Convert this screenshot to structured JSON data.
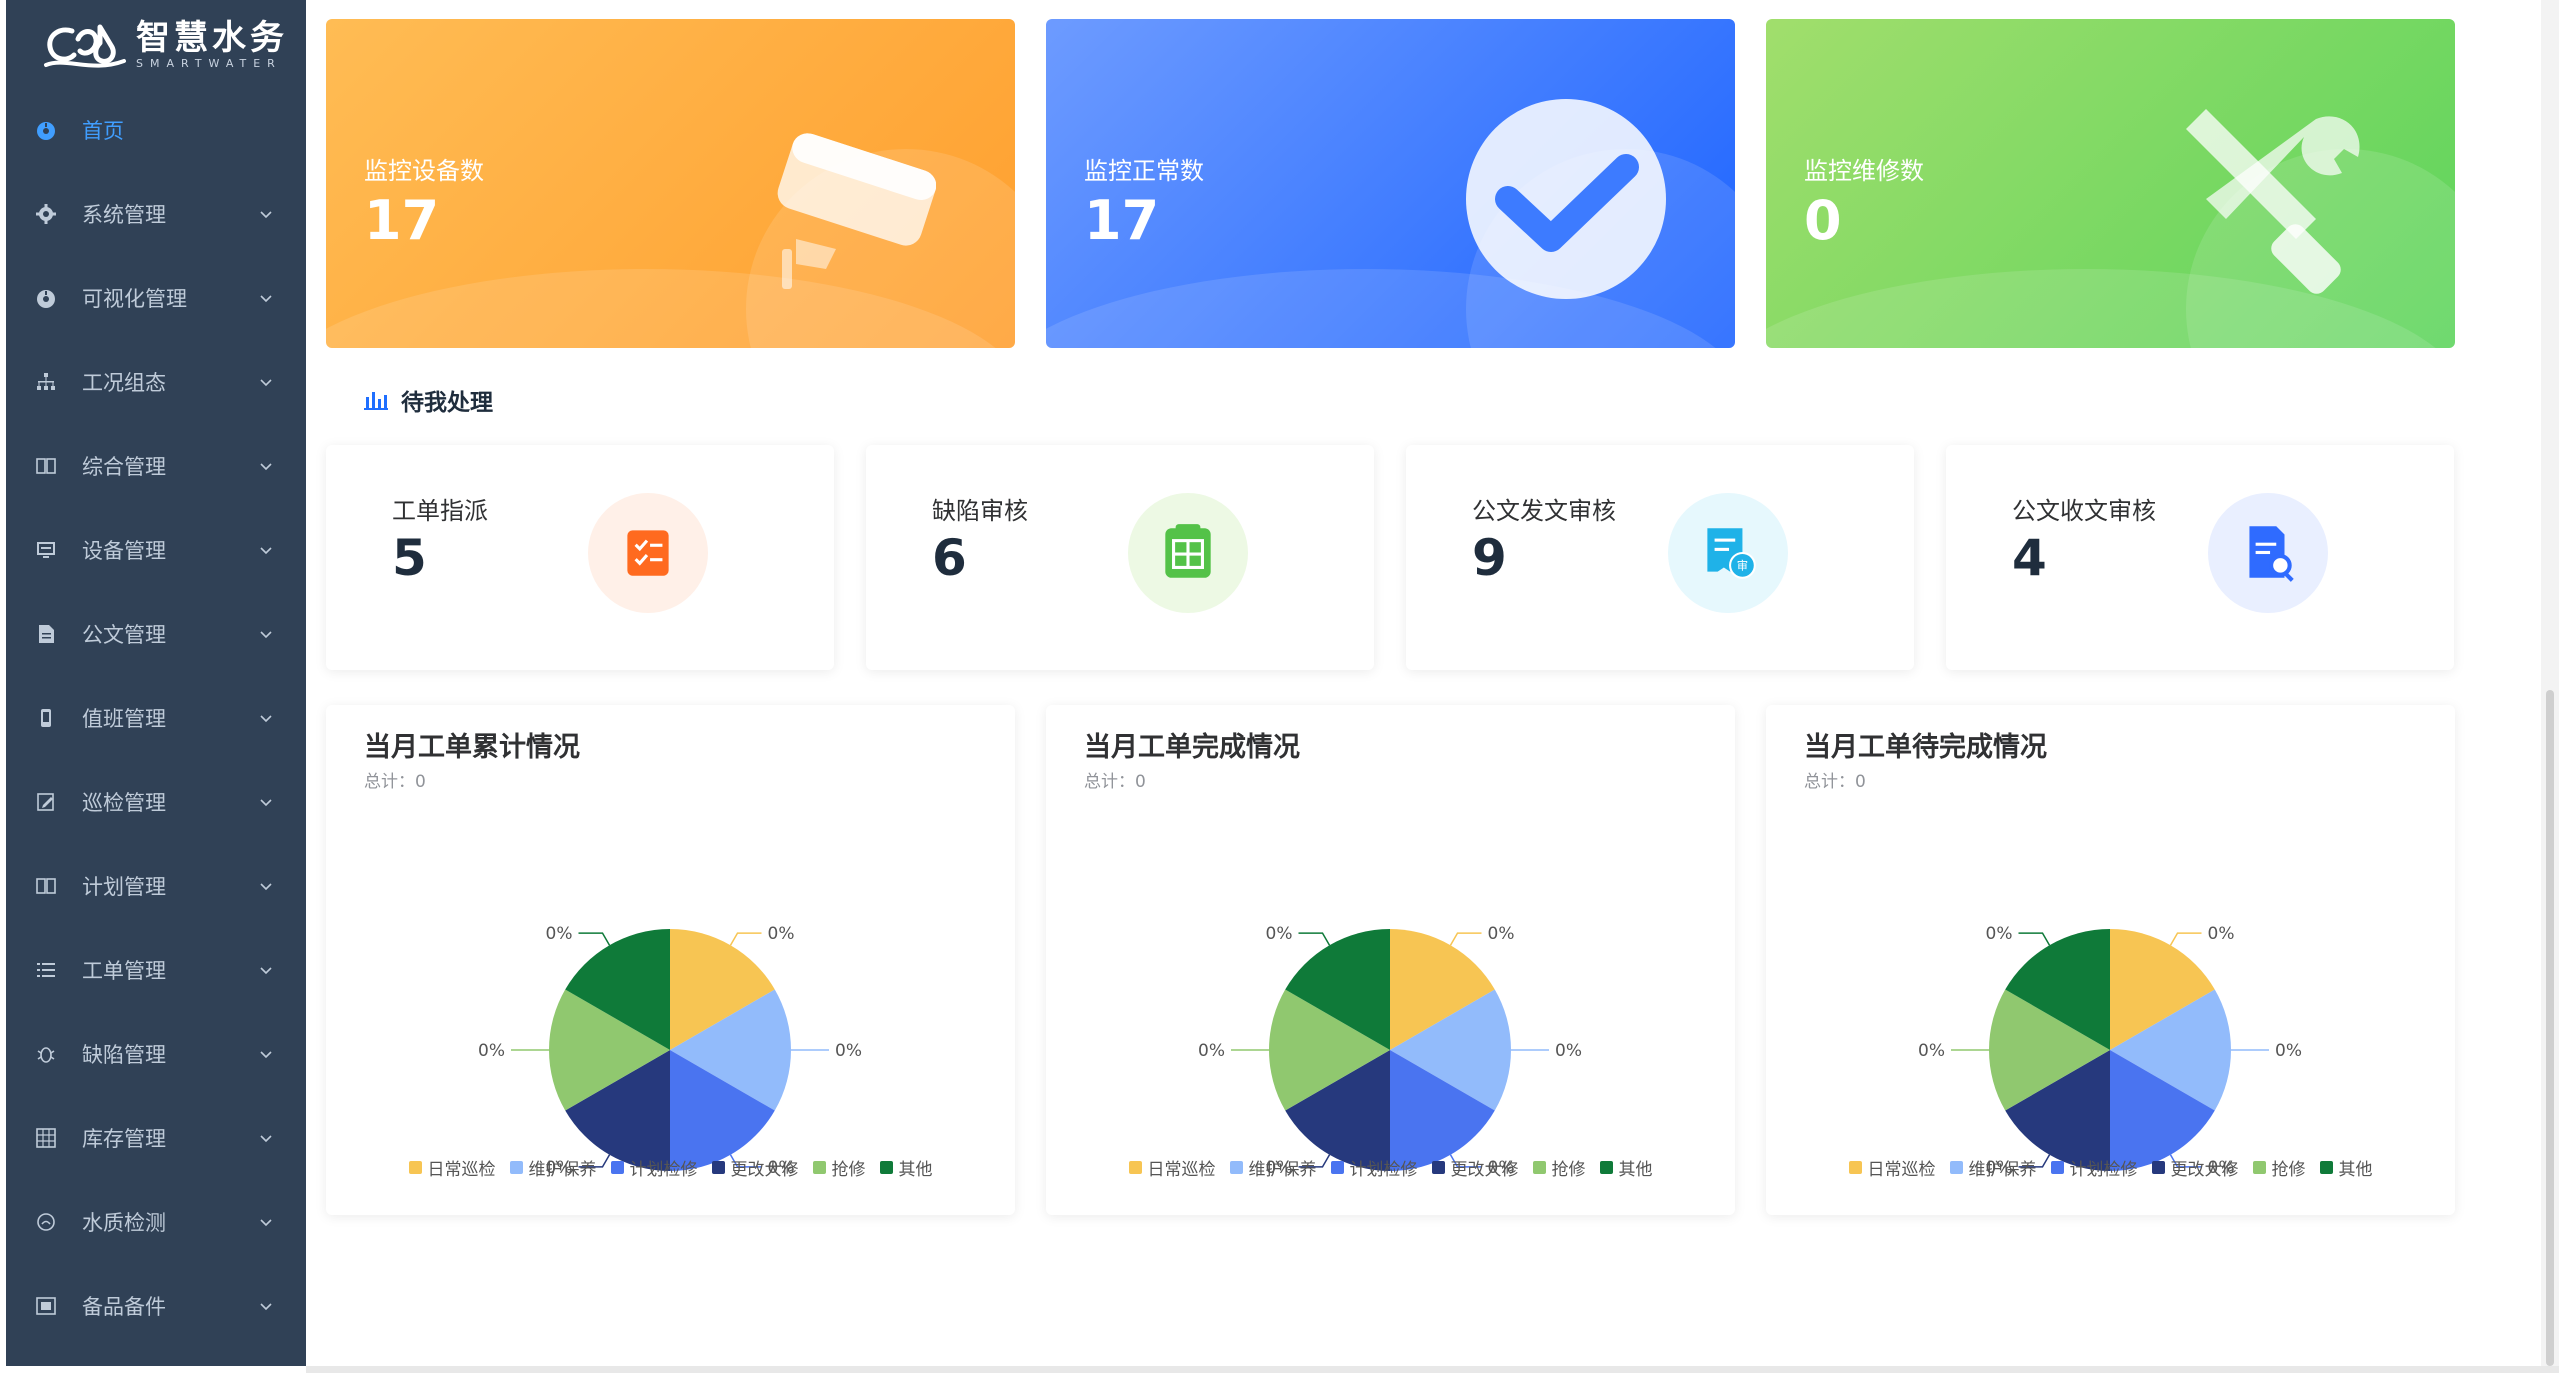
{
  "brand": {
    "name_cn": "智慧水务",
    "name_en": "SMARTWATER"
  },
  "menu": [
    {
      "label": "首页",
      "icon": "dashboard-icon",
      "active": true,
      "expandable": false
    },
    {
      "label": "系统管理",
      "icon": "gear-icon",
      "expandable": true
    },
    {
      "label": "可视化管理",
      "icon": "dashboard-icon",
      "expandable": true
    },
    {
      "label": "工况组态",
      "icon": "tree-icon",
      "expandable": true
    },
    {
      "label": "综合管理",
      "icon": "book-icon",
      "expandable": true
    },
    {
      "label": "设备管理",
      "icon": "monitor-icon",
      "expandable": true
    },
    {
      "label": "公文管理",
      "icon": "document-icon",
      "expandable": true
    },
    {
      "label": "值班管理",
      "icon": "phone-icon",
      "expandable": true
    },
    {
      "label": "巡检管理",
      "icon": "edit-icon",
      "expandable": true
    },
    {
      "label": "计划管理",
      "icon": "book-icon",
      "expandable": true
    },
    {
      "label": "工单管理",
      "icon": "list-icon",
      "expandable": true
    },
    {
      "label": "缺陷管理",
      "icon": "bug-icon",
      "expandable": true
    },
    {
      "label": "库存管理",
      "icon": "grid-icon",
      "expandable": true
    },
    {
      "label": "水质检测",
      "icon": "flask-icon",
      "expandable": true
    },
    {
      "label": "备品备件",
      "icon": "box-icon",
      "expandable": true
    }
  ],
  "stats": [
    {
      "label": "监控设备数",
      "value": "17",
      "icon": "camera-icon",
      "color_from": "#ffbc54",
      "color_to": "#ff9f2e"
    },
    {
      "label": "监控正常数",
      "value": "17",
      "icon": "check-icon",
      "color_from": "#6d9bff",
      "color_to": "#1c63ff"
    },
    {
      "label": "监控维修数",
      "value": "0",
      "icon": "tools-icon",
      "color_from": "#a1de6c",
      "color_to": "#5cd45c"
    }
  ],
  "section": {
    "title": "待我处理"
  },
  "todos": [
    {
      "label": "工单指派",
      "value": "5",
      "icon": "task-icon",
      "color": "#ff6a1f",
      "bg": "#fff0e8"
    },
    {
      "label": "缺陷审核",
      "value": "6",
      "icon": "audit-box-icon",
      "color": "#54c248",
      "bg": "#edf9e4"
    },
    {
      "label": "公文发文审核",
      "value": "9",
      "icon": "doc-send-icon",
      "color": "#1fb2e8",
      "bg": "#e6f8fd"
    },
    {
      "label": "公文收文审核",
      "value": "4",
      "icon": "doc-search-icon",
      "color": "#2f6bff",
      "bg": "#e9efff"
    }
  ],
  "chart_data": [
    {
      "type": "pie",
      "title": "当月工单累计情况",
      "total_text": "总计：0",
      "categories": [
        "日常巡检",
        "维护保养",
        "计划检修",
        "更改大修",
        "抢修",
        "其他"
      ],
      "values": [
        0,
        0,
        0,
        0,
        0,
        0
      ],
      "slice_labels": [
        "0%",
        "0%",
        "0%",
        "0%",
        "0%",
        "0%"
      ],
      "colors": [
        "#f7c553",
        "#92bbfb",
        "#4a74f0",
        "#26397d",
        "#90c86f",
        "#0f7a39"
      ],
      "legend": "bottom"
    },
    {
      "type": "pie",
      "title": "当月工单完成情况",
      "total_text": "总计：0",
      "categories": [
        "日常巡检",
        "维护保养",
        "计划检修",
        "更改大修",
        "抢修",
        "其他"
      ],
      "values": [
        0,
        0,
        0,
        0,
        0,
        0
      ],
      "slice_labels": [
        "0%",
        "0%",
        "0%",
        "0%",
        "0%",
        "0%"
      ],
      "colors": [
        "#f7c553",
        "#92bbfb",
        "#4a74f0",
        "#26397d",
        "#90c86f",
        "#0f7a39"
      ],
      "legend": "bottom"
    },
    {
      "type": "pie",
      "title": "当月工单待完成情况",
      "total_text": "总计：0",
      "categories": [
        "日常巡检",
        "维护保养",
        "计划检修",
        "更改大修",
        "抢修",
        "其他"
      ],
      "values": [
        0,
        0,
        0,
        0,
        0,
        0
      ],
      "slice_labels": [
        "0%",
        "0%",
        "0%",
        "0%",
        "0%",
        "0%"
      ],
      "colors": [
        "#f7c553",
        "#92bbfb",
        "#4a74f0",
        "#26397d",
        "#90c86f",
        "#0f7a39"
      ],
      "legend": "bottom"
    }
  ]
}
